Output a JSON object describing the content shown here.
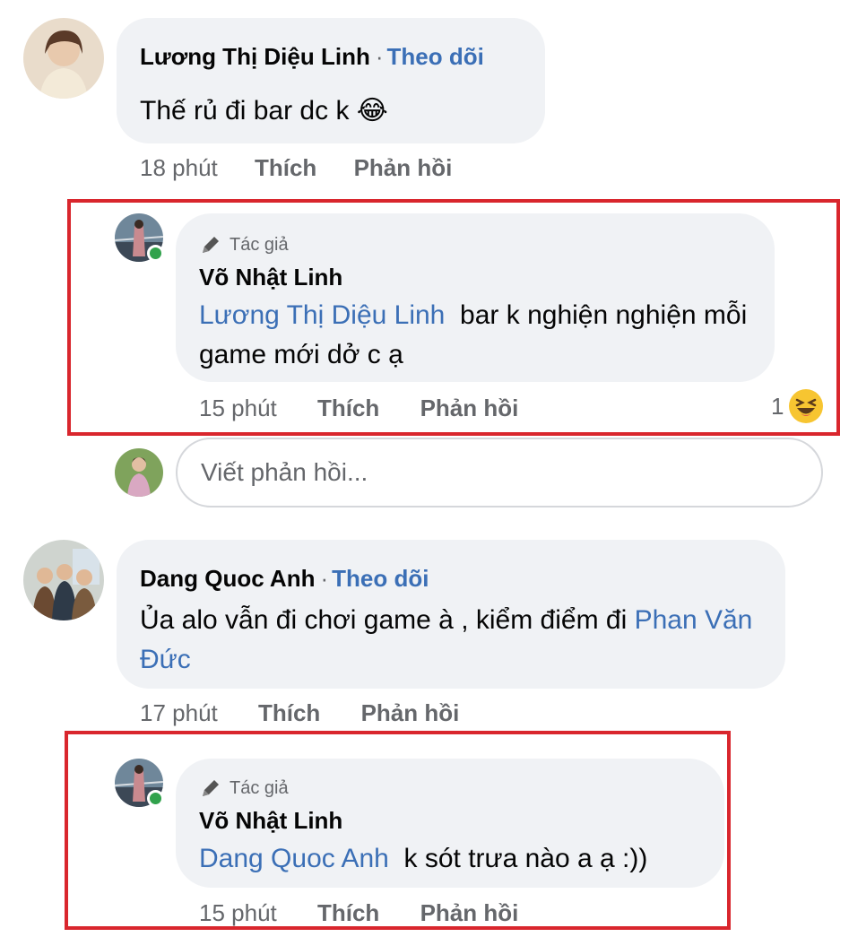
{
  "comments": [
    {
      "author": "Lương Thị Diệu Linh",
      "follow_label": "Theo dõi",
      "separator": "·",
      "text": "Thế rủ đi bar dc k",
      "emoji": "😂",
      "time": "18 phút",
      "like_label": "Thích",
      "reply_label": "Phản hồi"
    },
    {
      "author": "Dang Quoc Anh",
      "follow_label": "Theo dõi",
      "separator": "·",
      "text": "Ủa alo vẫn đi chơi game à , kiểm điểm đi ",
      "mention": "Phan Văn Đức",
      "time": "17 phút",
      "like_label": "Thích",
      "reply_label": "Phản hồi"
    }
  ],
  "replies": [
    {
      "author_tag": "Tác giả",
      "author": "Võ Nhật Linh",
      "mention": "Lương Thị Diệu Linh",
      "text": "  bar k nghiện nghiện mỗi game mới dở c ạ",
      "time": "15 phút",
      "like_label": "Thích",
      "reply_label": "Phản hồi",
      "reaction_count": "1",
      "reaction_icon": "laughing-squint-emoji"
    },
    {
      "author_tag": "Tác giả",
      "author": "Võ Nhật Linh",
      "mention": "Dang Quoc Anh",
      "text": "  k sót trưa nào a ạ :))",
      "time": "15 phút",
      "like_label": "Thích",
      "reply_label": "Phản hồi"
    }
  ],
  "reply_box": {
    "placeholder": "Viết phản hồi..."
  },
  "colors": {
    "highlight_border": "#d9262d",
    "link_blue": "#3b6fb6",
    "bubble_bg": "#f0f2f5",
    "meta_gray": "#65676b",
    "online_green": "#31a24c"
  }
}
